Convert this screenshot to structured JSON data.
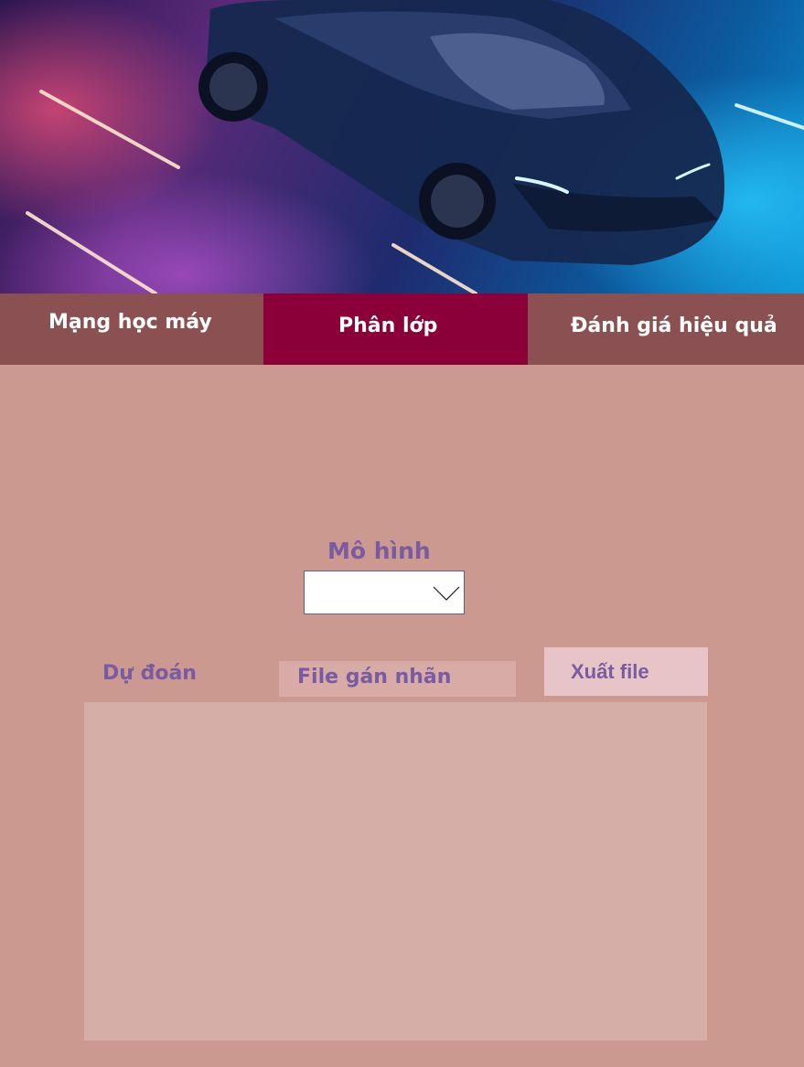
{
  "header": {
    "banner_image": "sports-car-neon-banner"
  },
  "tabs": [
    {
      "label": "Mạng học máy",
      "active": false
    },
    {
      "label": "Phân lớp",
      "active": true
    },
    {
      "label": "Đánh giá hiệu quả",
      "active": false
    }
  ],
  "model_select": {
    "label": "Mô hình",
    "value": "",
    "icon": "chevron-down-icon"
  },
  "prediction": {
    "label": "Dự đoán"
  },
  "file_field": {
    "value": "File gán nhãn"
  },
  "export": {
    "label": "Xuất file"
  },
  "colors": {
    "background": "#cc9990",
    "tab": "#8b5052",
    "tab_active": "#8b0038",
    "label_text": "#7a5aa0",
    "results_panel": "#d6aea8"
  }
}
